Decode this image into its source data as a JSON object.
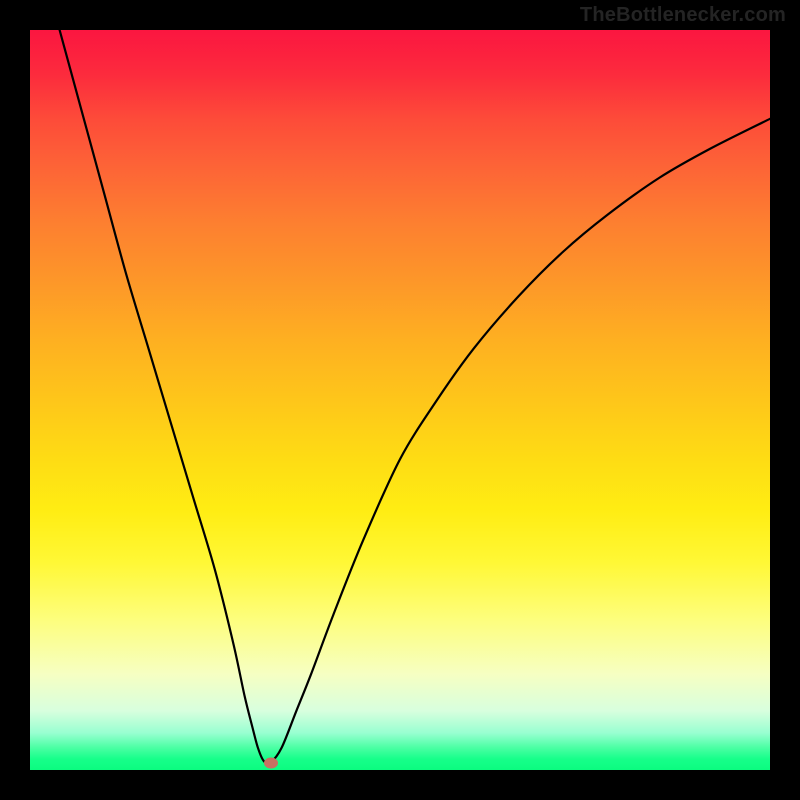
{
  "watermark": "TheBottlenecker.com",
  "chart_data": {
    "type": "line",
    "title": "",
    "xlabel": "",
    "ylabel": "",
    "xlim": [
      0,
      100
    ],
    "ylim": [
      0,
      100
    ],
    "series": [
      {
        "name": "bottleneck-curve",
        "x": [
          4,
          7,
          10,
          13,
          16,
          19,
          22,
          25,
          27.5,
          29,
          30,
          30.8,
          31.6,
          32.5,
          34,
          36,
          38,
          41,
          45,
          50,
          55,
          60,
          66,
          72,
          78,
          85,
          92,
          100
        ],
        "values": [
          100,
          89,
          78,
          67,
          57,
          47,
          37,
          27,
          17,
          10,
          6,
          3,
          1.2,
          1.0,
          3,
          8,
          13,
          21,
          31,
          42,
          50,
          57,
          64,
          70,
          75,
          80,
          84,
          88
        ]
      }
    ],
    "marker": {
      "x": 32.5,
      "y": 1.0,
      "color": "#c77062"
    },
    "gradient_stops": [
      {
        "pct": 0,
        "color": "#fb1640"
      },
      {
        "pct": 50,
        "color": "#fec61a"
      },
      {
        "pct": 80,
        "color": "#fdfe80"
      },
      {
        "pct": 100,
        "color": "#0bfc80"
      }
    ]
  }
}
